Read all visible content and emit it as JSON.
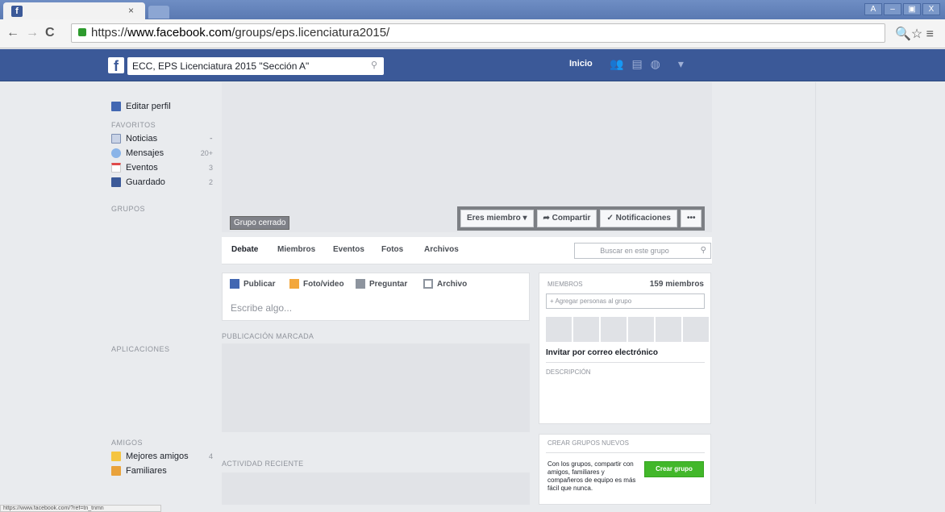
{
  "browser": {
    "tab": {
      "close": "×"
    },
    "window_buttons": [
      "A",
      "–",
      "▣",
      "X"
    ],
    "url_scheme": "https://",
    "url_host": "www.facebook.com",
    "url_path": "/groups/eps.licenciatura2015/",
    "status_url": "https://www.facebook.com/?ref=tn_tnmn"
  },
  "fb_header": {
    "search_value": "ECC, EPS Licenciatura 2015 \"Sección A\"",
    "home_label": "Inicio"
  },
  "sidebar": {
    "edit_profile": "Editar perfil",
    "favorites_heading": "FAVORITOS",
    "favorites": [
      {
        "label": "Noticias",
        "count": ""
      },
      {
        "label": "Mensajes",
        "count": "20+"
      },
      {
        "label": "Eventos",
        "count": "3"
      },
      {
        "label": "Guardado",
        "count": "2"
      }
    ],
    "groups_heading": "GRUPOS",
    "apps_heading": "APLICACIONES",
    "friends_heading": "AMIGOS",
    "friends": [
      {
        "label": "Mejores amigos",
        "count": "4"
      },
      {
        "label": "Familiares",
        "count": ""
      }
    ]
  },
  "group": {
    "privacy_badge": "Grupo cerrado",
    "member_button": "Eres miembro ▾",
    "share_button": "➦ Compartir",
    "notifications_button": "✓ Notificaciones",
    "more_button": "•••",
    "tabs": [
      "Debate",
      "Miembros",
      "Eventos",
      "Fotos",
      "Archivos"
    ],
    "search_placeholder": "Buscar en este grupo"
  },
  "composer": {
    "options": [
      "Publicar",
      "Foto/video",
      "Preguntar",
      "Archivo"
    ],
    "input_placeholder": "Escribe algo..."
  },
  "feed": {
    "pinned_label": "PUBLICACIÓN MARCADA",
    "recent_label": "ACTIVIDAD RECIENTE"
  },
  "members": {
    "heading": "MIEMBROS",
    "count": "159 miembros",
    "add_placeholder": "+ Agregar personas al grupo",
    "invite": "Invitar por correo electrónico",
    "description_heading": "DESCRIPCIÓN"
  },
  "create_groups": {
    "heading": "CREAR GRUPOS NUEVOS",
    "text": "Con los grupos, compartir con amigos, familiares y compañeros de equipo es más fácil que nunca.",
    "button": "Crear grupo"
  },
  "colors": {
    "facebook_blue": "#3b5998",
    "create_green": "#42b72a"
  }
}
